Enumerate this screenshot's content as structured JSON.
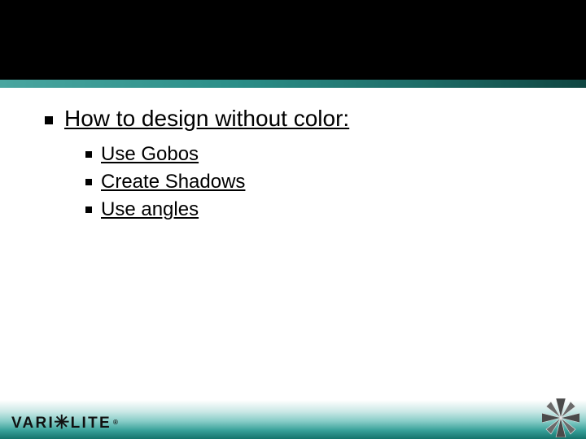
{
  "content": {
    "heading": "How to design without color:",
    "items": [
      "Use Gobos",
      "Create Shadows",
      "Use angles"
    ]
  },
  "logo": {
    "part1": "VARI",
    "part2": "LITE",
    "registered": "®"
  }
}
